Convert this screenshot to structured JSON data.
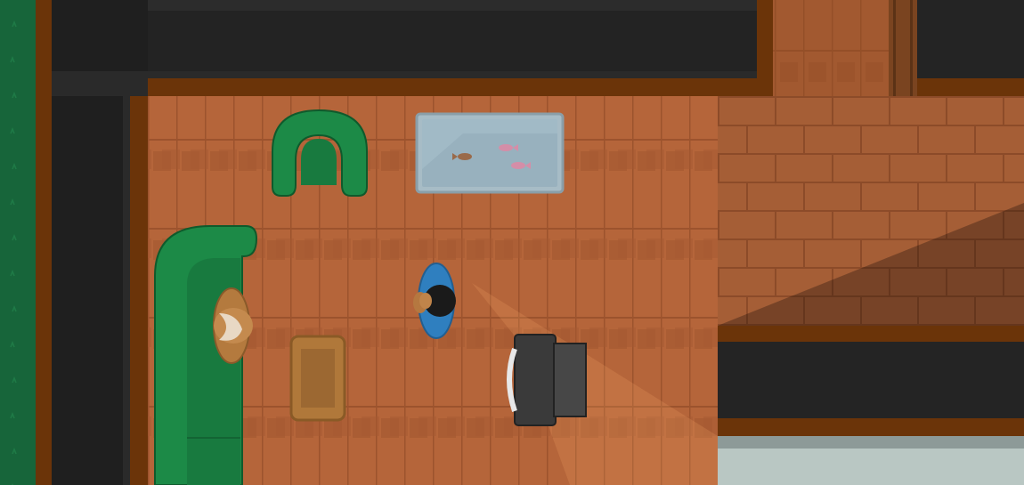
{
  "scene": {
    "view": "top-down",
    "room": "living-room",
    "colors": {
      "grass": "#17653a",
      "wall_trim": "#6b3409",
      "wall_dark": "#222222",
      "floor_wood": "#b5653a",
      "sofa_green": "#1c8a47",
      "aquarium_water": "#9fb4bf",
      "tv_body": "#3a3a3a",
      "player_shirt": "#2f7fbf",
      "npc_hat": "#b47a3e"
    },
    "objects": [
      {
        "kind": "sofa",
        "color": "green",
        "icon": "sofa-icon"
      },
      {
        "kind": "armchair",
        "color": "green",
        "icon": "armchair-icon"
      },
      {
        "kind": "aquarium",
        "fish_count": 3,
        "icon": "fish-tank-icon"
      },
      {
        "kind": "side-table",
        "icon": "table-icon"
      },
      {
        "kind": "television",
        "state": "on",
        "icon": "tv-icon"
      },
      {
        "kind": "player-character",
        "facing": "right",
        "icon": "player-icon"
      },
      {
        "kind": "npc-seated",
        "hat": "cowboy",
        "icon": "npc-icon"
      }
    ]
  }
}
